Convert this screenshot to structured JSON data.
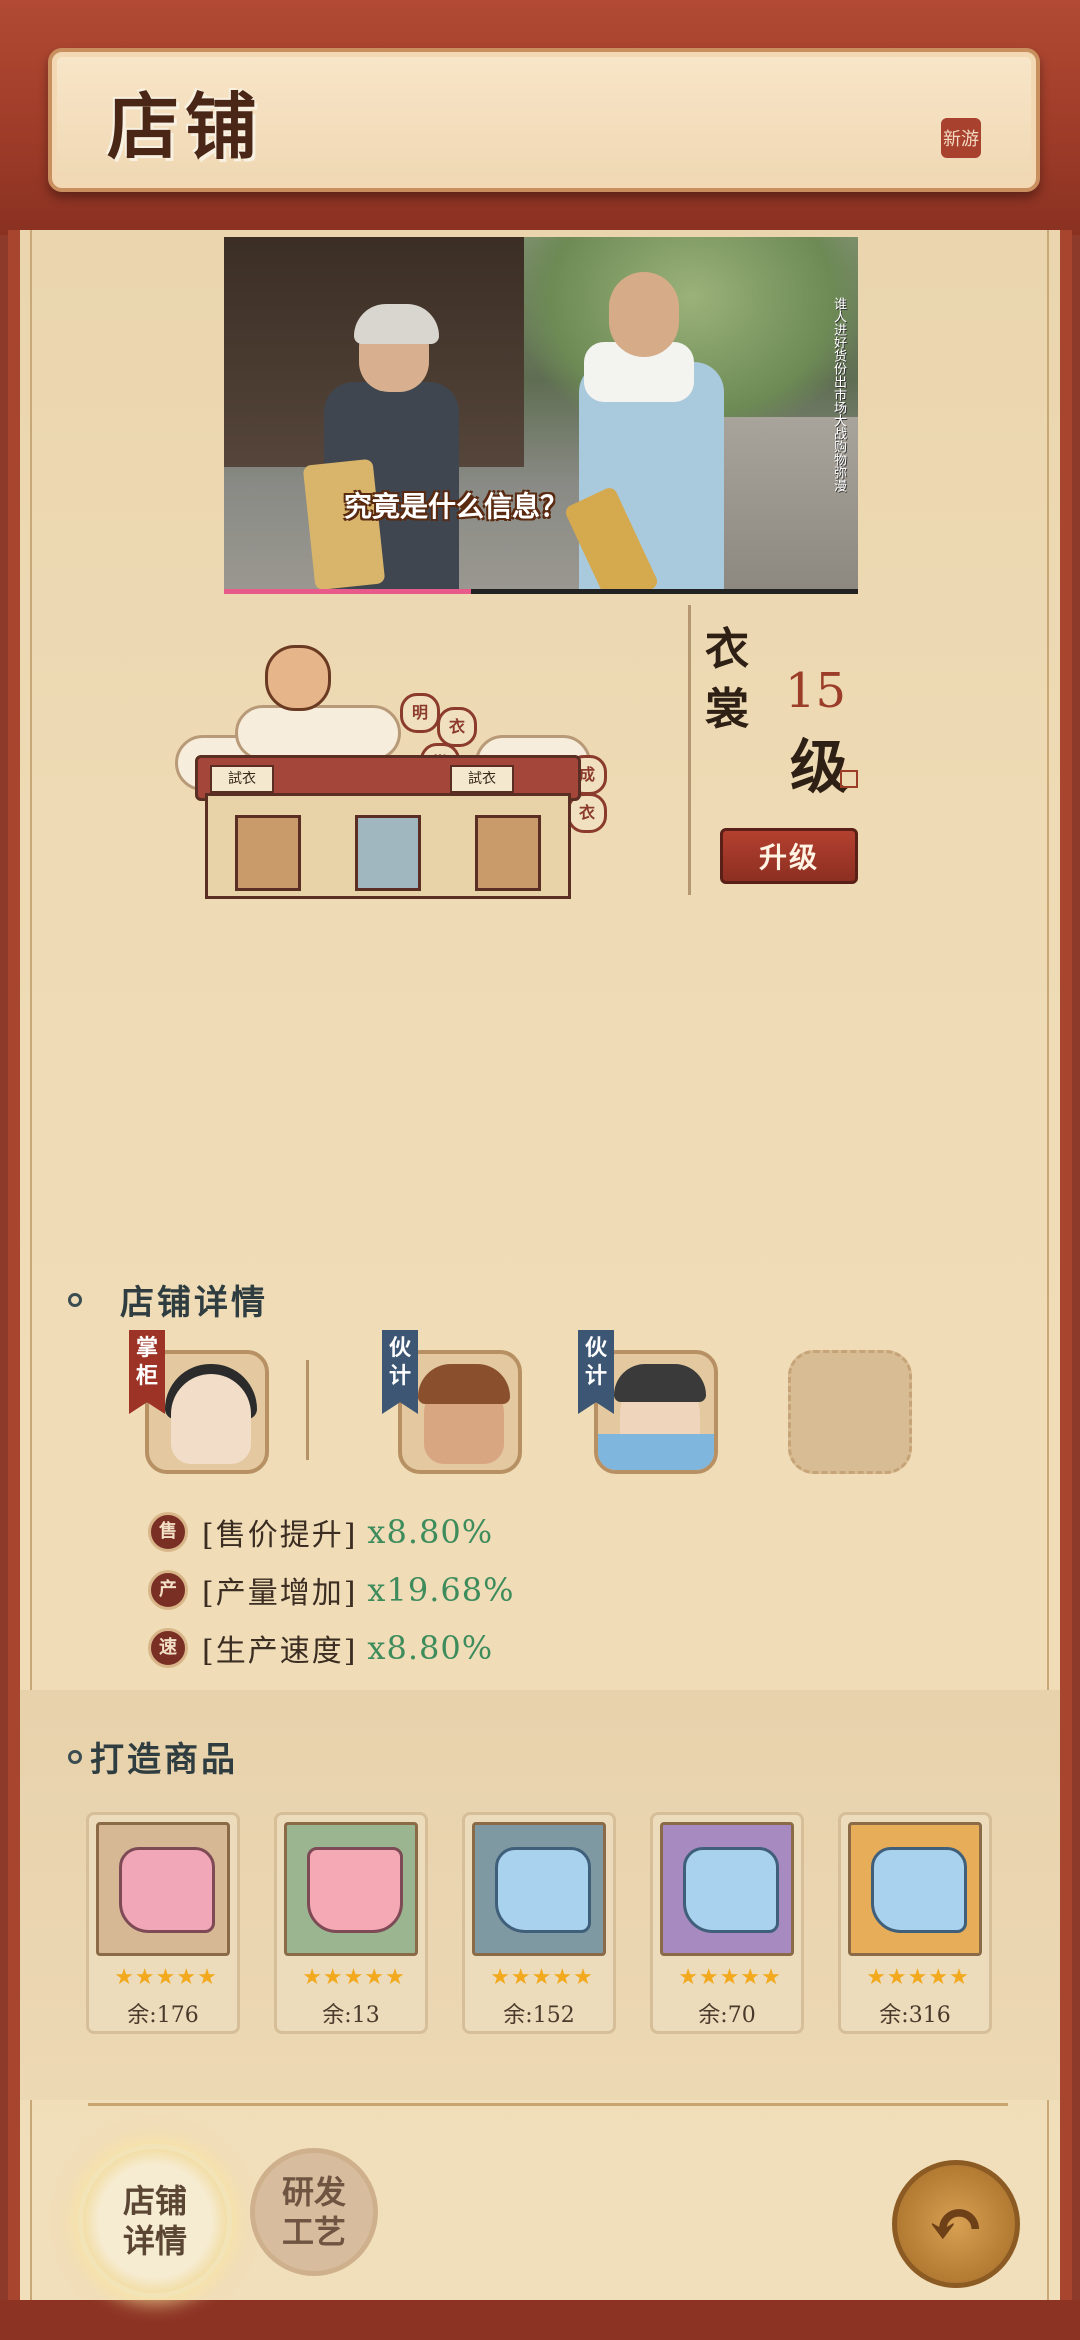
{
  "header": {
    "title": "店铺",
    "seal_text": "新游"
  },
  "video": {
    "caption": "究竟是什么信息？",
    "side_text": "谁人进好货份出市场大战购物弥漫",
    "progress": 0.39
  },
  "shop": {
    "name": "衣裳",
    "level": "15",
    "level_unit": "级",
    "upgrade_label": "升级",
    "signs": [
      "試衣",
      "試衣"
    ],
    "circle_signs": [
      "明",
      "衣",
      "裳",
      "成",
      "衣"
    ]
  },
  "details": {
    "title": "店铺详情",
    "staff": [
      {
        "tag": "掌柜",
        "tag_color": "#9c3326"
      },
      {
        "tag": "伙计",
        "tag_color": "#3d5673"
      },
      {
        "tag": "伙计",
        "tag_color": "#3d5673"
      }
    ],
    "buffs": [
      {
        "icon": "售",
        "label": "[售价提升]",
        "value": "x8.80%"
      },
      {
        "icon": "产",
        "label": "[产量增加]",
        "value": "x19.68%"
      },
      {
        "icon": "速",
        "label": "[生产速度]",
        "value": "x8.80%"
      }
    ]
  },
  "craft": {
    "title": "打造商品",
    "items": [
      {
        "icon": "pink-robe-icon",
        "stars": "★★★★★",
        "count": "余:176",
        "bg": "#d7b894"
      },
      {
        "icon": "pink-skirt-icon",
        "stars": "★★★★★",
        "count": "余:13",
        "bg": "#9ab58f"
      },
      {
        "icon": "blue-cloth-icon",
        "stars": "★★★★★",
        "count": "余:152",
        "bg": "#7f99a3"
      },
      {
        "icon": "blue-cloth-icon",
        "stars": "★★★★★",
        "count": "余:70",
        "bg": "#a78ac0"
      },
      {
        "icon": "blue-cloth-icon",
        "stars": "★★★★★",
        "count": "余:316",
        "bg": "#e7ad58"
      }
    ]
  },
  "nav": {
    "detail_label_1": "店铺",
    "detail_label_2": "详情",
    "craft_label_1": "研发",
    "craft_label_2": "工艺",
    "back_icon": "↶"
  }
}
